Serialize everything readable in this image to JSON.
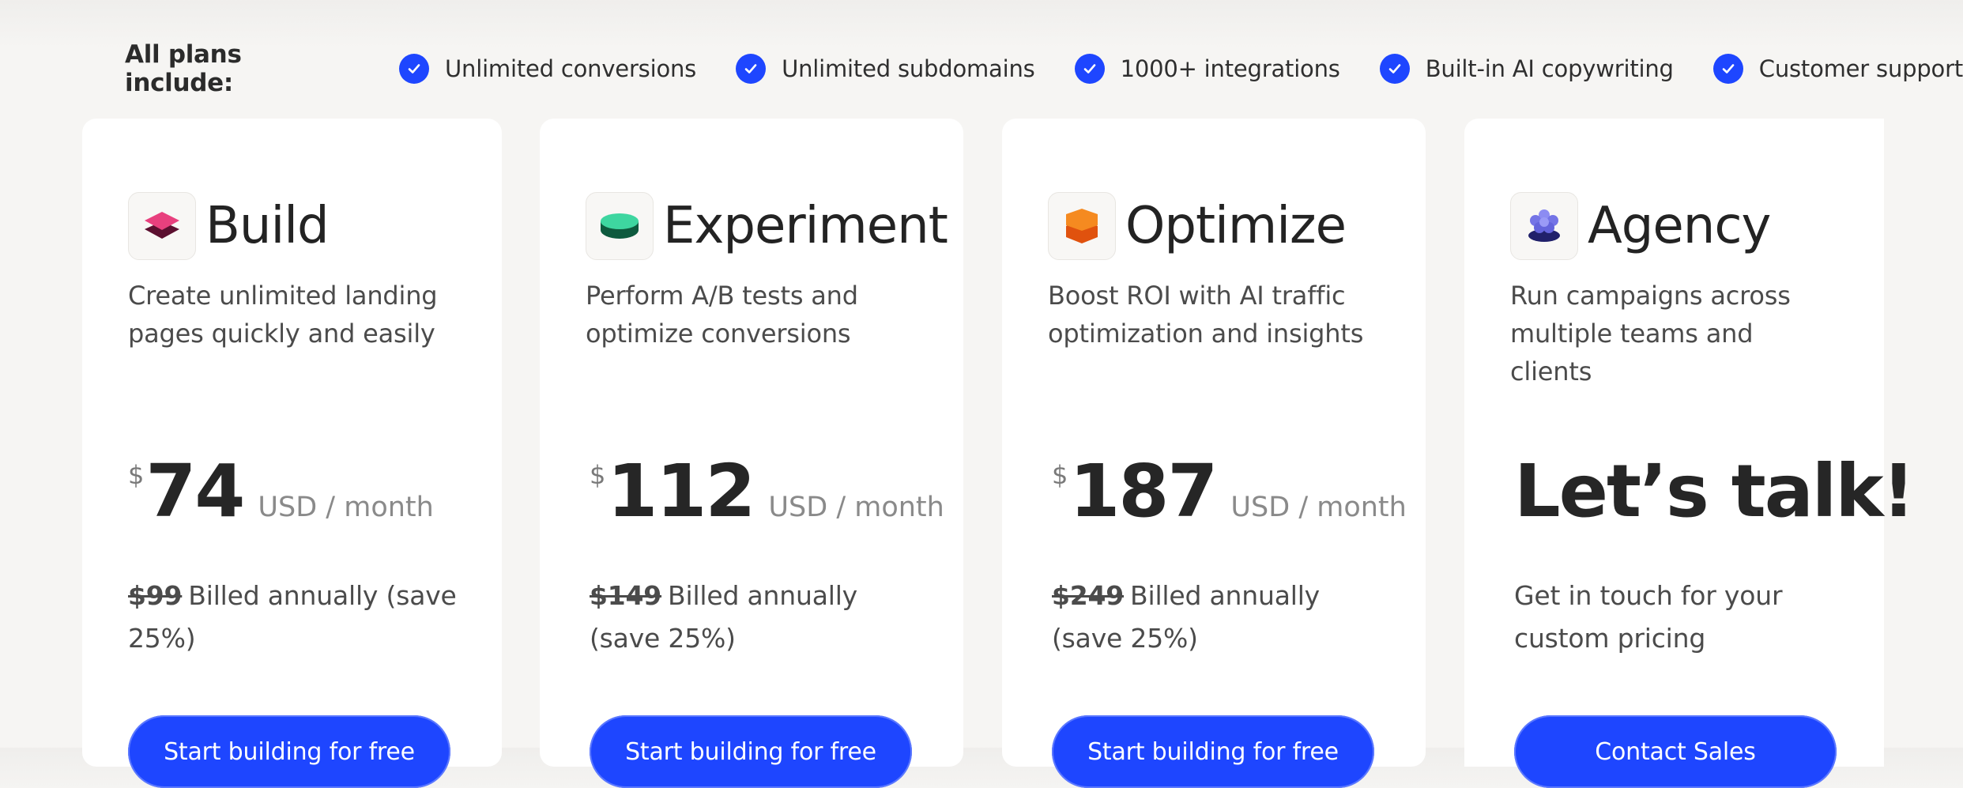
{
  "includes": {
    "label": "All plans include:",
    "features": [
      "Unlimited conversions",
      "Unlimited subdomains",
      "1000+ integrations",
      "Built-in AI copywriting",
      "Customer support"
    ]
  },
  "colors": {
    "accent": "#1e46ff",
    "build_icon": "#e8407e",
    "experiment_icon": "#2ec89a",
    "optimize_icon": "#f07a1a",
    "agency_icon": "#5a5ad8"
  },
  "plans": [
    {
      "name": "Build",
      "icon": "stacked-layers-pink-icon",
      "description": "Create unlimited landing pages quickly and easily",
      "currency": "$",
      "price": "74",
      "period": "USD / month",
      "original_price": "$99",
      "billing_note": "Billed annually (save 25%)",
      "cta": "Start building for free"
    },
    {
      "name": "Experiment",
      "icon": "stacked-discs-green-icon",
      "description": "Perform A/B tests and optimize conversions",
      "currency": "$",
      "price": "112",
      "period": "USD / month",
      "original_price": "$149",
      "billing_note": "Billed annually (save 25%)",
      "cta": "Start building for free"
    },
    {
      "name": "Optimize",
      "icon": "stacked-hexagons-orange-icon",
      "description": "Boost ROI with AI traffic optimization and insights",
      "currency": "$",
      "price": "187",
      "period": "USD / month",
      "original_price": "$249",
      "billing_note": "Billed annually (save 25%)",
      "cta": "Start building for free"
    },
    {
      "name": "Agency",
      "icon": "stacked-flower-purple-icon",
      "description": "Run campaigns across multiple teams and clients",
      "headline": "Let’s talk!",
      "note": "Get in touch for your custom pricing",
      "cta": "Contact Sales"
    }
  ]
}
